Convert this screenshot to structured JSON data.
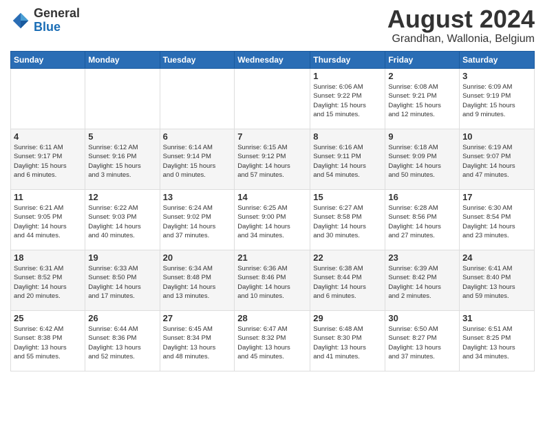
{
  "header": {
    "logo_line1": "General",
    "logo_line2": "Blue",
    "month": "August 2024",
    "location": "Grandhan, Wallonia, Belgium"
  },
  "days_of_week": [
    "Sunday",
    "Monday",
    "Tuesday",
    "Wednesday",
    "Thursday",
    "Friday",
    "Saturday"
  ],
  "weeks": [
    [
      {
        "day": "",
        "info": ""
      },
      {
        "day": "",
        "info": ""
      },
      {
        "day": "",
        "info": ""
      },
      {
        "day": "",
        "info": ""
      },
      {
        "day": "1",
        "info": "Sunrise: 6:06 AM\nSunset: 9:22 PM\nDaylight: 15 hours\nand 15 minutes."
      },
      {
        "day": "2",
        "info": "Sunrise: 6:08 AM\nSunset: 9:21 PM\nDaylight: 15 hours\nand 12 minutes."
      },
      {
        "day": "3",
        "info": "Sunrise: 6:09 AM\nSunset: 9:19 PM\nDaylight: 15 hours\nand 9 minutes."
      }
    ],
    [
      {
        "day": "4",
        "info": "Sunrise: 6:11 AM\nSunset: 9:17 PM\nDaylight: 15 hours\nand 6 minutes."
      },
      {
        "day": "5",
        "info": "Sunrise: 6:12 AM\nSunset: 9:16 PM\nDaylight: 15 hours\nand 3 minutes."
      },
      {
        "day": "6",
        "info": "Sunrise: 6:14 AM\nSunset: 9:14 PM\nDaylight: 15 hours\nand 0 minutes."
      },
      {
        "day": "7",
        "info": "Sunrise: 6:15 AM\nSunset: 9:12 PM\nDaylight: 14 hours\nand 57 minutes."
      },
      {
        "day": "8",
        "info": "Sunrise: 6:16 AM\nSunset: 9:11 PM\nDaylight: 14 hours\nand 54 minutes."
      },
      {
        "day": "9",
        "info": "Sunrise: 6:18 AM\nSunset: 9:09 PM\nDaylight: 14 hours\nand 50 minutes."
      },
      {
        "day": "10",
        "info": "Sunrise: 6:19 AM\nSunset: 9:07 PM\nDaylight: 14 hours\nand 47 minutes."
      }
    ],
    [
      {
        "day": "11",
        "info": "Sunrise: 6:21 AM\nSunset: 9:05 PM\nDaylight: 14 hours\nand 44 minutes."
      },
      {
        "day": "12",
        "info": "Sunrise: 6:22 AM\nSunset: 9:03 PM\nDaylight: 14 hours\nand 40 minutes."
      },
      {
        "day": "13",
        "info": "Sunrise: 6:24 AM\nSunset: 9:02 PM\nDaylight: 14 hours\nand 37 minutes."
      },
      {
        "day": "14",
        "info": "Sunrise: 6:25 AM\nSunset: 9:00 PM\nDaylight: 14 hours\nand 34 minutes."
      },
      {
        "day": "15",
        "info": "Sunrise: 6:27 AM\nSunset: 8:58 PM\nDaylight: 14 hours\nand 30 minutes."
      },
      {
        "day": "16",
        "info": "Sunrise: 6:28 AM\nSunset: 8:56 PM\nDaylight: 14 hours\nand 27 minutes."
      },
      {
        "day": "17",
        "info": "Sunrise: 6:30 AM\nSunset: 8:54 PM\nDaylight: 14 hours\nand 23 minutes."
      }
    ],
    [
      {
        "day": "18",
        "info": "Sunrise: 6:31 AM\nSunset: 8:52 PM\nDaylight: 14 hours\nand 20 minutes."
      },
      {
        "day": "19",
        "info": "Sunrise: 6:33 AM\nSunset: 8:50 PM\nDaylight: 14 hours\nand 17 minutes."
      },
      {
        "day": "20",
        "info": "Sunrise: 6:34 AM\nSunset: 8:48 PM\nDaylight: 14 hours\nand 13 minutes."
      },
      {
        "day": "21",
        "info": "Sunrise: 6:36 AM\nSunset: 8:46 PM\nDaylight: 14 hours\nand 10 minutes."
      },
      {
        "day": "22",
        "info": "Sunrise: 6:38 AM\nSunset: 8:44 PM\nDaylight: 14 hours\nand 6 minutes."
      },
      {
        "day": "23",
        "info": "Sunrise: 6:39 AM\nSunset: 8:42 PM\nDaylight: 14 hours\nand 2 minutes."
      },
      {
        "day": "24",
        "info": "Sunrise: 6:41 AM\nSunset: 8:40 PM\nDaylight: 13 hours\nand 59 minutes."
      }
    ],
    [
      {
        "day": "25",
        "info": "Sunrise: 6:42 AM\nSunset: 8:38 PM\nDaylight: 13 hours\nand 55 minutes."
      },
      {
        "day": "26",
        "info": "Sunrise: 6:44 AM\nSunset: 8:36 PM\nDaylight: 13 hours\nand 52 minutes."
      },
      {
        "day": "27",
        "info": "Sunrise: 6:45 AM\nSunset: 8:34 PM\nDaylight: 13 hours\nand 48 minutes."
      },
      {
        "day": "28",
        "info": "Sunrise: 6:47 AM\nSunset: 8:32 PM\nDaylight: 13 hours\nand 45 minutes."
      },
      {
        "day": "29",
        "info": "Sunrise: 6:48 AM\nSunset: 8:30 PM\nDaylight: 13 hours\nand 41 minutes."
      },
      {
        "day": "30",
        "info": "Sunrise: 6:50 AM\nSunset: 8:27 PM\nDaylight: 13 hours\nand 37 minutes."
      },
      {
        "day": "31",
        "info": "Sunrise: 6:51 AM\nSunset: 8:25 PM\nDaylight: 13 hours\nand 34 minutes."
      }
    ]
  ]
}
